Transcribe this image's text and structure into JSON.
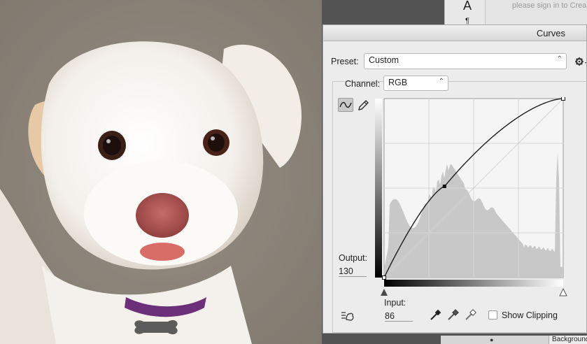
{
  "dialog": {
    "title": "Curves",
    "preset_label": "Preset:",
    "preset_value": "Custom",
    "channel_label": "Channel:",
    "channel_value": "RGB",
    "output_label": "Output:",
    "output_value": "130",
    "input_label": "Input:",
    "input_value": "86",
    "show_clipping_label": "Show Clipping",
    "show_clipping_checked": false,
    "curve_point": {
      "input": 86,
      "output": 130
    }
  },
  "panels": {
    "tool_glyph_type": "A",
    "tool_glyph_paragraph": "¶",
    "libraries_message": "please sign in to Crea",
    "layer_name": "Background"
  },
  "icons": [
    "curve-edit-icon",
    "pencil-icon",
    "gear-icon",
    "hand-target-icon",
    "black-eyedropper-icon",
    "gray-eyedropper-icon",
    "white-eyedropper-icon",
    "eye-icon",
    "black-point-slider-icon",
    "white-point-slider-icon"
  ],
  "colors": {
    "dialog_bg": "#ececec",
    "histogram": "#c8c8c8",
    "workspace": "#535353"
  }
}
